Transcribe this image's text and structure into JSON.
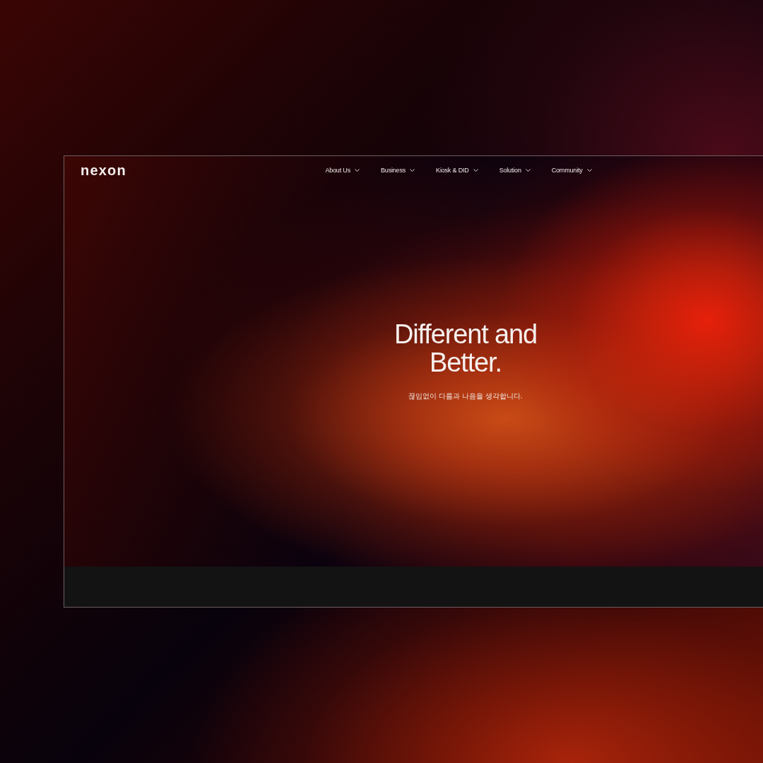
{
  "logo": {
    "text": "nexon"
  },
  "nav": {
    "items": [
      {
        "label": "About Us"
      },
      {
        "label": "Business"
      },
      {
        "label": "Kiosk & DID"
      },
      {
        "label": "Solution"
      },
      {
        "label": "Community"
      }
    ]
  },
  "hero": {
    "title_lines": [
      "Different and",
      "Better."
    ],
    "subtitle": "끊임없이 다름과 나음을 생각합니다."
  }
}
